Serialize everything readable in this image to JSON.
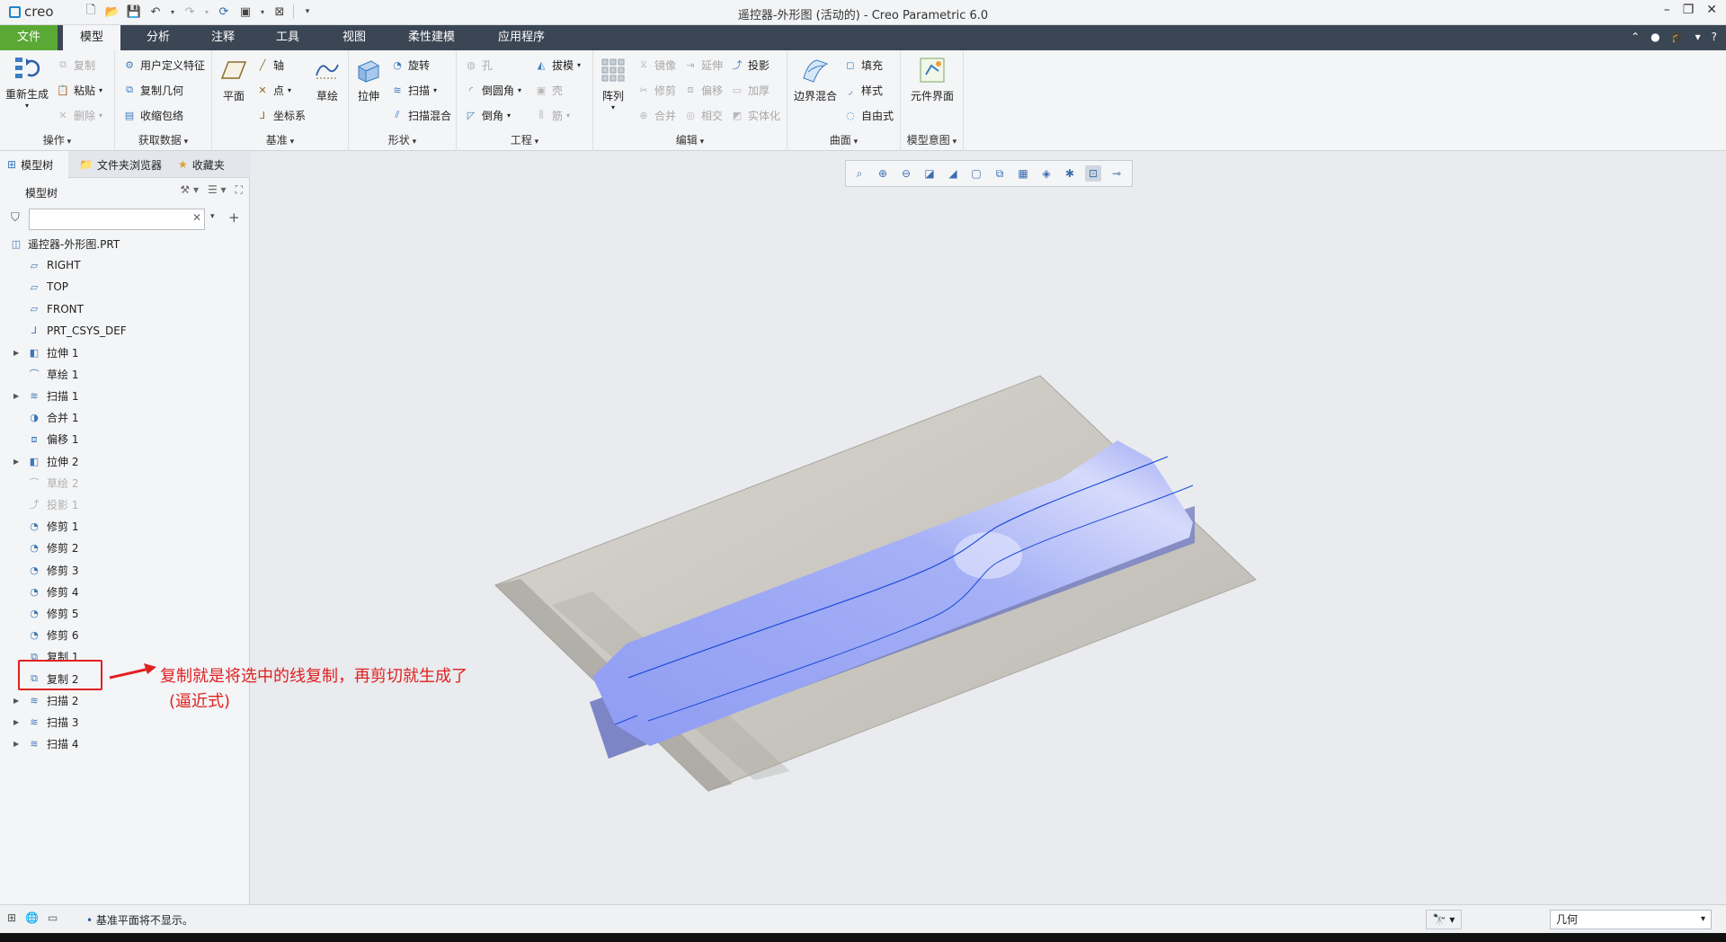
{
  "app": {
    "logo_text": "creo",
    "window_title": "遥控器-外形图 (活动的) - Creo Parametric 6.0"
  },
  "tabs": [
    {
      "label": "文件"
    },
    {
      "label": "模型"
    },
    {
      "label": "分析"
    },
    {
      "label": "注释"
    },
    {
      "label": "工具"
    },
    {
      "label": "视图"
    },
    {
      "label": "柔性建模"
    },
    {
      "label": "应用程序"
    }
  ],
  "ribbon": {
    "operations": {
      "label": "操作",
      "regenerate": "重新生成",
      "copy": "复制",
      "paste": "粘贴",
      "delete": "删除"
    },
    "get_data": {
      "label": "获取数据",
      "udf": "用户定义特征",
      "copy_geom": "复制几何",
      "shrinkwrap": "收缩包络"
    },
    "datum": {
      "label": "基准",
      "plane": "平面",
      "axis": "轴",
      "point": "点",
      "csys": "坐标系",
      "sketch": "草绘"
    },
    "shapes": {
      "label": "形状",
      "extrude": "拉伸",
      "revolve": "旋转",
      "sweep": "扫描",
      "swept_blend": "扫描混合"
    },
    "engineering": {
      "label": "工程",
      "hole": "孔",
      "round": "倒圆角",
      "chamfer": "倒角",
      "draft": "拔模",
      "shell": "壳",
      "rib": "筋"
    },
    "editing": {
      "label": "编辑",
      "pattern": "阵列",
      "mirror": "镜像",
      "trim": "修剪",
      "merge": "合并",
      "extend": "延伸",
      "offset": "偏移",
      "intersect": "相交",
      "project": "投影",
      "thicken": "加厚",
      "solidify": "实体化"
    },
    "surfaces": {
      "label": "曲面",
      "boundary_blend": "边界混合",
      "fill": "填充",
      "style": "样式",
      "freestyle": "自由式"
    },
    "intent": {
      "label": "模型意图",
      "component_interface": "元件界面"
    }
  },
  "left_panel": {
    "tabs": [
      {
        "label": "模型树"
      },
      {
        "label": "文件夹浏览器"
      },
      {
        "label": "收藏夹"
      }
    ],
    "header": "模型树",
    "search_value": "",
    "tree": [
      {
        "label": "遥控器-外形图.PRT",
        "icon": "part-icon",
        "expandable": false,
        "grey": false,
        "root": true
      },
      {
        "label": "RIGHT",
        "icon": "datum-plane-icon",
        "expandable": false,
        "grey": false
      },
      {
        "label": "TOP",
        "icon": "datum-plane-icon",
        "expandable": false,
        "grey": false
      },
      {
        "label": "FRONT",
        "icon": "datum-plane-icon",
        "expandable": false,
        "grey": false
      },
      {
        "label": "PRT_CSYS_DEF",
        "icon": "csys-icon",
        "expandable": false,
        "grey": false
      },
      {
        "label": "拉伸 1",
        "icon": "extrude-icon",
        "expandable": true,
        "grey": false
      },
      {
        "label": "草绘 1",
        "icon": "sketch-icon",
        "expandable": false,
        "grey": false
      },
      {
        "label": "扫描 1",
        "icon": "sweep-icon",
        "expandable": true,
        "grey": false
      },
      {
        "label": "合并 1",
        "icon": "merge-icon",
        "expandable": false,
        "grey": false
      },
      {
        "label": "偏移 1",
        "icon": "offset-icon",
        "expandable": false,
        "grey": false
      },
      {
        "label": "拉伸 2",
        "icon": "extrude-icon",
        "expandable": true,
        "grey": false
      },
      {
        "label": "草绘 2",
        "icon": "sketch-icon",
        "expandable": false,
        "grey": true
      },
      {
        "label": "投影 1",
        "icon": "project-icon",
        "expandable": false,
        "grey": true
      },
      {
        "label": "修剪 1",
        "icon": "trim-icon",
        "expandable": false,
        "grey": false
      },
      {
        "label": "修剪 2",
        "icon": "trim-icon",
        "expandable": false,
        "grey": false
      },
      {
        "label": "修剪 3",
        "icon": "trim-icon",
        "expandable": false,
        "grey": false
      },
      {
        "label": "修剪 4",
        "icon": "trim-icon",
        "expandable": false,
        "grey": false
      },
      {
        "label": "修剪 5",
        "icon": "trim-icon",
        "expandable": false,
        "grey": false
      },
      {
        "label": "修剪 6",
        "icon": "trim-icon",
        "expandable": false,
        "grey": false
      },
      {
        "label": "复制 1",
        "icon": "copy-icon",
        "expandable": false,
        "grey": false
      },
      {
        "label": "复制 2",
        "icon": "copy-icon",
        "expandable": false,
        "grey": false
      },
      {
        "label": "扫描 2",
        "icon": "sweep-icon",
        "expandable": true,
        "grey": false
      },
      {
        "label": "扫描 3",
        "icon": "sweep-icon",
        "expandable": true,
        "grey": false
      },
      {
        "label": "扫描 4",
        "icon": "sweep-icon",
        "expandable": true,
        "grey": false
      }
    ]
  },
  "annotation": {
    "line1": "复制就是将选中的线复制，再剪切就生成了",
    "line2": "(逼近式)",
    "color": "#e02020"
  },
  "status": {
    "message": "基准平面将不显示。",
    "filter_value": "几何"
  },
  "colors": {
    "file_tab": "#5aa935",
    "tab_bar": "#3b4654",
    "model_blue": "#8f9cf2",
    "sheet_grey": "#c9c7c2"
  }
}
